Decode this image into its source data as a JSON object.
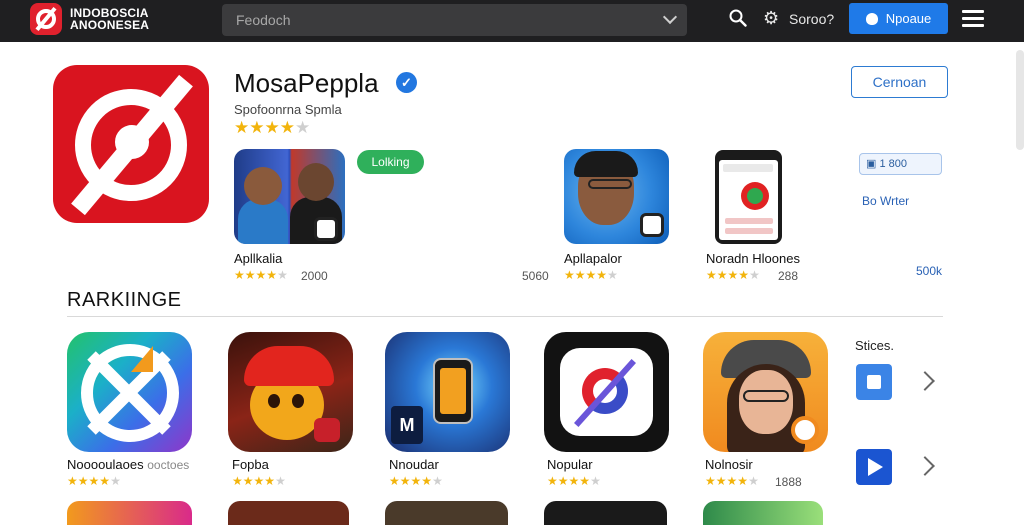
{
  "header": {
    "brand_line1": "INDOBOSCIA",
    "brand_line2": "ANOONESEA",
    "search_placeholder": "Feodoch",
    "settings_label": "Soroo?",
    "primary_button_label": "Npoaue"
  },
  "app": {
    "title": "MosaPeppla",
    "subtitle": "Spofoonrna Spmla",
    "rating_stars": 4,
    "open_button_label": "Cernoan"
  },
  "featured": {
    "tag_label": "Lolking",
    "items": [
      {
        "label": "Apllkalia",
        "stars": 4,
        "count": "2000"
      },
      {
        "label": "Apllapalor",
        "stars": 4,
        "count": "5060"
      },
      {
        "label": "Noradn Hloones",
        "stars": 4,
        "count": "288"
      }
    ],
    "side_badge": "1 800",
    "side_link": "Bo Wrter",
    "side_count": "500k"
  },
  "rankings": {
    "title": "RARKIINGE",
    "items": [
      {
        "label": "Nooooulaoes",
        "sub": "ooctoes",
        "stars": 4,
        "count": ""
      },
      {
        "label": "Fopba",
        "sub": "",
        "stars": 4,
        "count": ""
      },
      {
        "label": "Nnoudar",
        "sub": "",
        "stars": 4,
        "count": ""
      },
      {
        "label": "Nopular",
        "sub": "",
        "stars": 4,
        "count": ""
      },
      {
        "label": "Nolnosir",
        "sub": "",
        "stars": 4,
        "count": "1888"
      }
    ],
    "sidebar_heading": "Stices."
  },
  "colors": {
    "topbar": "#1f1f21",
    "accent_blue": "#1f7ae8",
    "brand_red": "#d9141f",
    "star": "#f2b40c",
    "tag_green": "#2fb05b"
  },
  "icons": [
    "search-icon",
    "gear-icon",
    "menu-icon",
    "verified-icon",
    "star-icon",
    "chevron-right-icon",
    "play-icon",
    "stop-icon"
  ]
}
